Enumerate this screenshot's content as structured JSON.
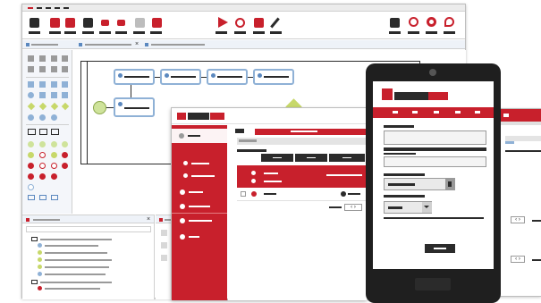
{
  "app": {
    "title": "",
    "toolbar": {
      "items": [
        "new",
        "save",
        "save-as",
        "export",
        "import",
        "copy",
        "paste",
        "run",
        "debug",
        "deploy",
        "edit",
        "print",
        "settings",
        "record",
        "hot"
      ]
    },
    "colors": {
      "accent": "#c8202c",
      "dark": "#2b2b2b",
      "node_border": "#8fb1d6",
      "gateway": "#c7d86a",
      "start_event": "#cfe39b"
    }
  },
  "mobile_form": {
    "button_label": ""
  },
  "tablet_app": {
    "pager": "‹ ›"
  }
}
